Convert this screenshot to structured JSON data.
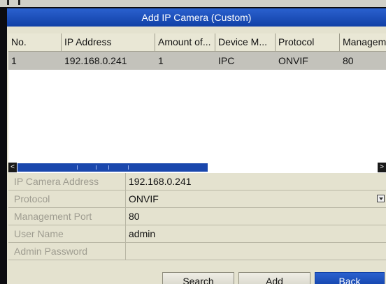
{
  "dialog": {
    "title": "Add IP Camera (Custom)"
  },
  "table": {
    "columns": [
      "No.",
      "IP Address",
      "Amount of...",
      "Device M...",
      "Protocol",
      "Managem"
    ],
    "rows": [
      {
        "no": "1",
        "ip": "192.168.0.241",
        "amount": "1",
        "device_model": "IPC",
        "protocol": "ONVIF",
        "management_port": "80"
      }
    ],
    "scroll_left_glyph": "<",
    "scroll_right_glyph": ">"
  },
  "form": {
    "ip_camera_address": {
      "label": "IP Camera Address",
      "value": "192.168.0.241"
    },
    "protocol": {
      "label": "Protocol",
      "value": "ONVIF"
    },
    "management_port": {
      "label": "Management Port",
      "value": "80"
    },
    "user_name": {
      "label": "User Name",
      "value": "admin"
    },
    "admin_password": {
      "label": "Admin Password",
      "value": ""
    }
  },
  "buttons": {
    "search": "Search",
    "add": "Add",
    "back": "Back"
  },
  "colors": {
    "accent": "#1a47ad",
    "selected_row": "#c3c2bb",
    "panel": "#e4e2cf"
  }
}
